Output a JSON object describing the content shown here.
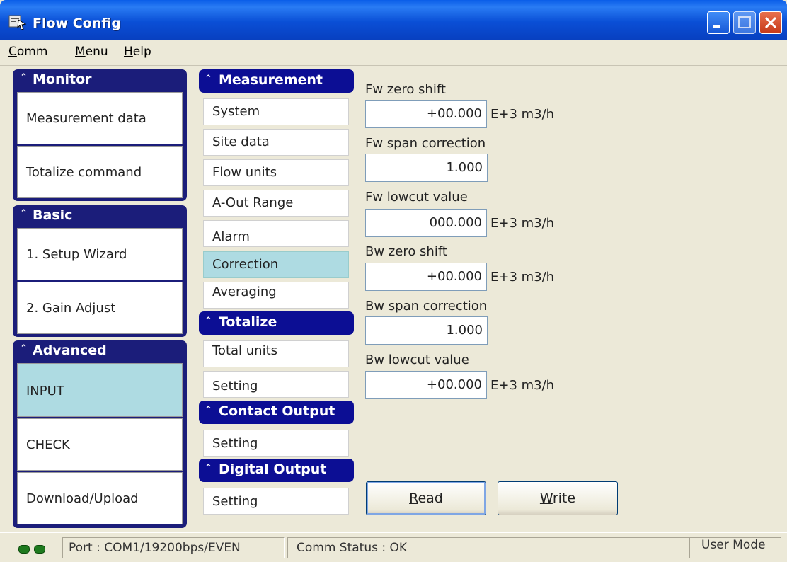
{
  "window": {
    "title": "Flow Config"
  },
  "menubar": {
    "items": [
      {
        "label": "Comm",
        "accel": "C",
        "rest": "omm"
      },
      {
        "label": "Menu",
        "accel": "M",
        "rest": "enu"
      },
      {
        "label": "Help",
        "accel": "H",
        "rest": "elp"
      }
    ]
  },
  "sidebar": {
    "monitor": {
      "title": "Monitor",
      "items": [
        "Measurement data",
        "Totalize command"
      ]
    },
    "basic": {
      "title": "Basic",
      "items": [
        "1. Setup Wizard",
        "2. Gain Adjust"
      ]
    },
    "advanced": {
      "title": "Advanced",
      "items": [
        "INPUT",
        "CHECK",
        "Download/Upload"
      ],
      "selected": "INPUT"
    }
  },
  "submenu": {
    "measurement": {
      "title": "Measurement",
      "items": [
        "System",
        "Site data",
        "Flow units",
        "A-Out Range",
        "Alarm",
        "Correction",
        "Averaging"
      ],
      "selected": "Correction"
    },
    "totalize": {
      "title": "Totalize",
      "items": [
        "Total units",
        "Setting"
      ]
    },
    "contact_output": {
      "title": "Contact Output",
      "items": [
        "Setting"
      ]
    },
    "digital_output": {
      "title": "Digital Output",
      "items": [
        "Setting"
      ]
    }
  },
  "fields": {
    "fw_zero_shift": {
      "label": "Fw zero shift",
      "value": "+00.000",
      "unit": "E+3 m3/h"
    },
    "fw_span_correction": {
      "label": "Fw span correction",
      "value": "1.000"
    },
    "fw_lowcut_value": {
      "label": "Fw lowcut value",
      "value": "000.000",
      "unit": "E+3 m3/h"
    },
    "bw_zero_shift": {
      "label": "Bw zero shift",
      "value": "+00.000",
      "unit": "E+3 m3/h"
    },
    "bw_span_correction": {
      "label": "Bw span correction",
      "value": "1.000"
    },
    "bw_lowcut_value": {
      "label": "Bw lowcut value",
      "value": "+00.000",
      "unit": "E+3 m3/h"
    }
  },
  "actions": {
    "read": {
      "accel": "R",
      "rest": "ead"
    },
    "write": {
      "accel": "W",
      "rest": "rite"
    }
  },
  "statusbar": {
    "port": "Port : COM1/19200bps/EVEN",
    "comm_status": "Comm Status :  OK",
    "mode": "User Mode"
  },
  "colors": {
    "titlebar": "#0a4fd6",
    "group_header": "#1b1d7a",
    "section_header": "#0c0e94",
    "selected": "#aedbe2",
    "led": "#1e7a1e"
  },
  "icons": {
    "app": "app-window-icon",
    "chevron": "double-chevron-up-icon"
  }
}
